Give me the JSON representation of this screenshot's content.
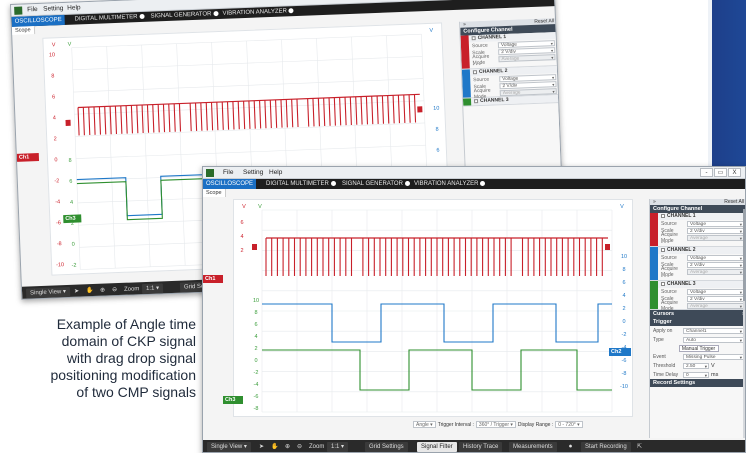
{
  "caption": {
    "lines": [
      "Example of Angle time",
      "domain of CKP signal",
      "with drag drop signal",
      "positioning modification",
      "of two CMP signals"
    ]
  },
  "colors": {
    "ch1": "#c8202a",
    "ch2": "#1f78c8",
    "ch3": "#2f8f2f",
    "tab_active": "#1a6fc4",
    "brand_blue": "#1f4896"
  },
  "app": {
    "menu": [
      "File",
      "Setting",
      "Help"
    ],
    "window_controls": [
      "-",
      "▭",
      "X"
    ],
    "tabs": [
      "OSCILLOSCOPE",
      "DIGITAL MULTIMETER",
      "SIGNAL GENERATOR",
      "VIBRATION ANALYZER"
    ],
    "subtab": "Scope",
    "panel": {
      "expand_icon": "double-chevron-right-icon",
      "reset_all": "Reset All",
      "configure_title": "Configure Channel",
      "channels": [
        {
          "name": "CHANNEL 1",
          "source_label": "Source",
          "source": "Voltage",
          "scale_label": "Scale",
          "scale": "2 V/div",
          "acquire_label": "Acquire Mode",
          "acquire": "Average"
        },
        {
          "name": "CHANNEL 2",
          "source_label": "Source",
          "source": "Voltage",
          "scale_label": "Scale",
          "scale": "2 V/div",
          "acquire_label": "Acquire Mode",
          "acquire": "Average"
        },
        {
          "name": "CHANNEL 3",
          "source_label": "Source",
          "source": "Voltage",
          "scale_label": "Scale",
          "scale": "2 V/div",
          "acquire_label": "Acquire Mode",
          "acquire": "Average"
        }
      ],
      "cursors_title": "Cursors",
      "trigger_title": "Trigger",
      "trigger": {
        "apply_on_label": "Apply on",
        "apply_on": "Channel1",
        "type_label": "Type",
        "type": "Auto",
        "manual_trigger": "Manual Trigger",
        "event_label": "Event",
        "event": "Missing Pulse",
        "threshold_label": "Threshold",
        "threshold": "2.50",
        "threshold_unit": "V",
        "time_delay_label": "Time Delay",
        "time_delay": "0",
        "time_delay_unit": "ms"
      },
      "record_title": "Record Settings"
    },
    "toolbar": {
      "view": "Single View",
      "zoom_label": "Zoom",
      "zoom_value": "1:1",
      "grid_settings": "Grid Settings",
      "signal_filter": "Signal Filter",
      "history_trace": "History Trace",
      "measurements": "Measurements",
      "start_recording": "Start Recording",
      "grid_short": "Grid Se"
    },
    "angle_bar": {
      "mode": "Angle",
      "trigger_interval_label": "Trigger Interval :",
      "trigger_interval": "360° / Trigger",
      "display_range_label": "Display Range :",
      "display_range": "0 - 720°"
    },
    "axis_units": {
      "left": "V",
      "right": "V"
    },
    "back_window_ticks": {
      "red": [
        "10",
        "8",
        "6",
        "4",
        "2",
        "0",
        "-2",
        "-4",
        "-6",
        "-8",
        "-10"
      ],
      "green": [
        "8",
        "6",
        "4",
        "2",
        "0",
        "-2"
      ],
      "right_red": [
        "10",
        "8",
        "6"
      ]
    },
    "front_window_ticks": {
      "red": [
        "6",
        "4",
        "2"
      ],
      "green": [
        "10",
        "8",
        "6",
        "4",
        "2",
        "0",
        "-2",
        "-4",
        "-6",
        "-8",
        "-10"
      ],
      "right_red": [
        "10",
        "8",
        "6",
        "4",
        "2",
        "0",
        "-2",
        "-4",
        "-6",
        "-8",
        "-10"
      ]
    },
    "markers": {
      "ch1": "Ch1",
      "ch2": "Ch2",
      "ch3": "Ch3",
      "ch1_small": "10"
    }
  },
  "chart_data": {
    "type": "line",
    "series": [
      {
        "name": "Ch1",
        "description_values": "CKP tooth-pattern pulses",
        "values": []
      },
      {
        "name": "Ch2",
        "values": [
          1,
          1,
          0,
          0,
          1,
          1,
          0,
          0,
          1,
          1
        ]
      },
      {
        "name": "Ch3",
        "values": [
          1,
          1,
          0,
          0,
          1,
          1,
          0,
          0,
          1,
          1
        ]
      }
    ]
  }
}
